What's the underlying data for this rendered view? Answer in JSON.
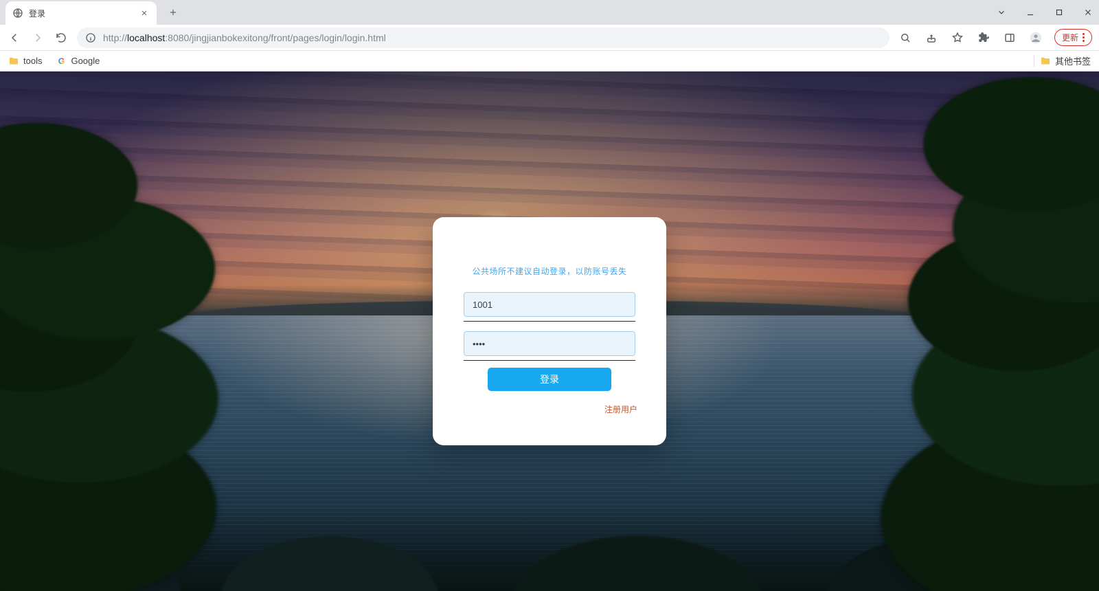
{
  "browser": {
    "tab_title": "登录",
    "url_prefix": "http://",
    "url_host": "localhost",
    "url_port_path": ":8080/jingjianbokexitong/front/pages/login/login.html",
    "update_label": "更新"
  },
  "bookmarks": {
    "tools": "tools",
    "google": "Google",
    "other": "其他书签"
  },
  "login": {
    "hint": "公共场所不建议自动登录，以防账号丢失",
    "username_value": "1001",
    "password_value": "••••",
    "submit_label": "登录",
    "register_label": "注册用户"
  }
}
